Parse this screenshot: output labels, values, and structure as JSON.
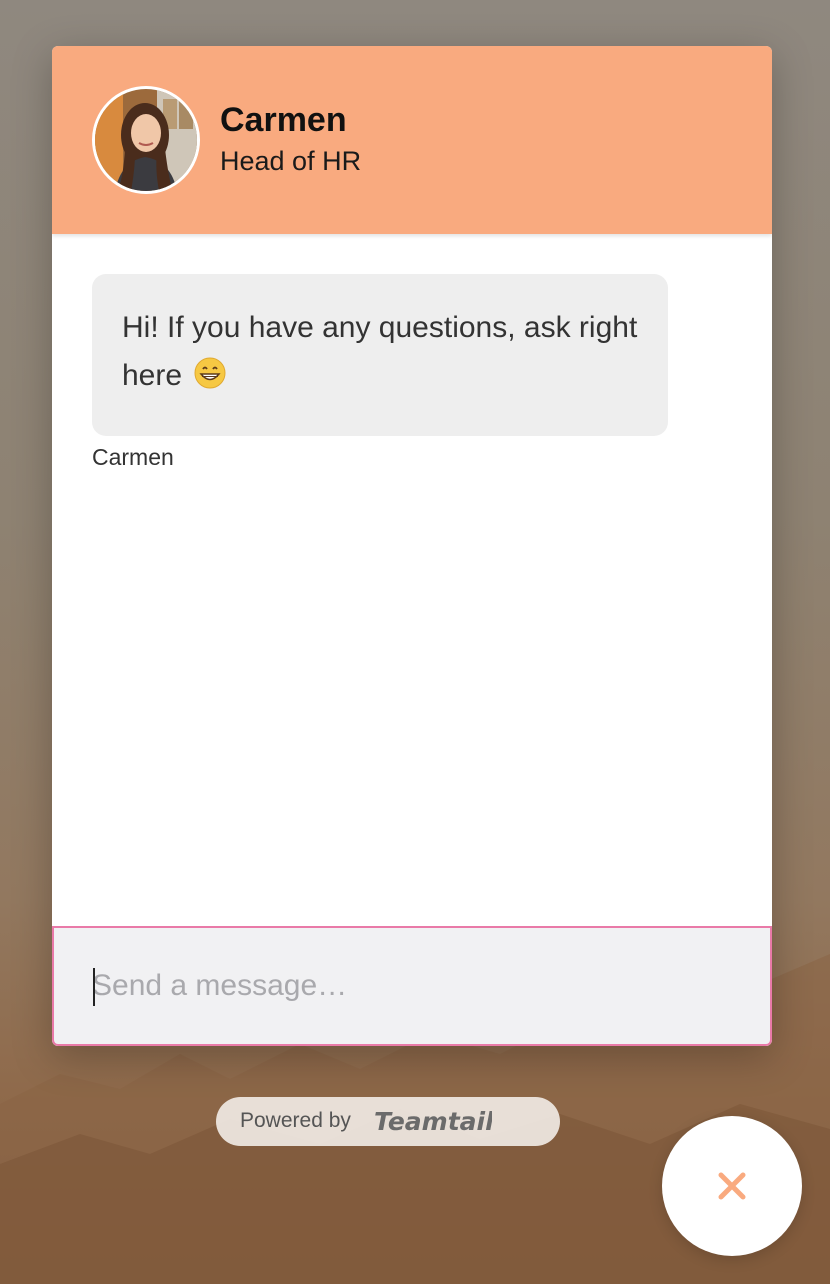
{
  "agent": {
    "name": "Carmen",
    "title": "Head of HR"
  },
  "messages": [
    {
      "text": "Hi! If you have any questions, ask right here",
      "emoji": "grinning-face-with-smiling-eyes",
      "sender": "Carmen"
    }
  ],
  "composer": {
    "placeholder": "Send a message…"
  },
  "footer": {
    "powered_by": "Powered by",
    "brand": "Teamtailor"
  },
  "close_button": {
    "icon": "close-icon"
  },
  "colors": {
    "header": "#f9aa7f",
    "accent_border": "#e97aa8",
    "bubble": "#eeeeee",
    "close_icon": "#f9aa7f"
  }
}
